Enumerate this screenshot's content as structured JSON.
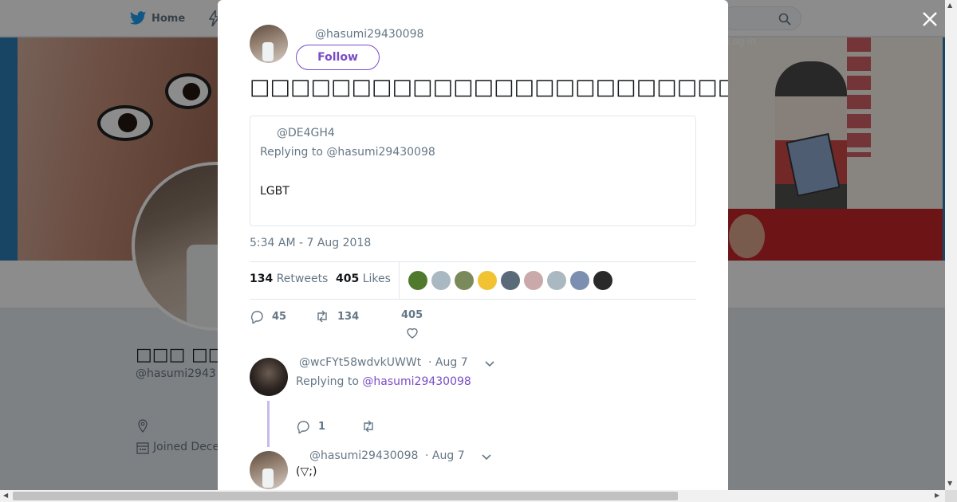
{
  "topbar": {
    "home_label": "Home",
    "login_label": "Log in"
  },
  "profile": {
    "name": "□□□ □□□",
    "handle": "@hasumi2943",
    "joined": "Joined Dece"
  },
  "tweet": {
    "handle": "@hasumi29430098",
    "follow_label": "Follow",
    "text": "□□□□□□□□□□□□□□□□□□□□□□□□□□□□□□□□□□□□□□□□□□□□□□□□□□□□□",
    "timestamp": "5:34 AM - 7 Aug 2018",
    "retweets_count": "134",
    "retweets_label": "Retweets",
    "likes_count": "405",
    "likes_label": "Likes",
    "likers_colors": [
      "#4f7a2e",
      "#aab8c2",
      "#7b8a5a",
      "#f1c232",
      "#5a6a78",
      "#c9a9a9",
      "#aab8c2",
      "#7d8fb0",
      "#2a2a2a"
    ],
    "actions": {
      "replies": "45",
      "retweets": "134",
      "likes": "405"
    }
  },
  "quote": {
    "handle": "@DE4GH4",
    "replying": "Replying to @hasumi29430098",
    "text": "LGBT"
  },
  "reply1": {
    "handle": "@wcFYt58wdvkUWWt",
    "date": "· Aug 7",
    "replying_prefix": "Replying to",
    "replying_handle": "@hasumi29430098",
    "replies": "1"
  },
  "reply2": {
    "handle": "@hasumi29430098",
    "date": "· Aug 7",
    "text": "(▽;)"
  }
}
